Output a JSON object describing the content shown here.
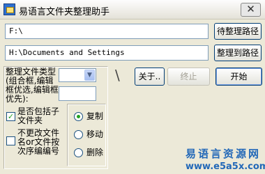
{
  "window": {
    "title": "易语言文件夹整理助手",
    "close_glyph": "✕"
  },
  "paths": {
    "source_value": "F:\\",
    "target_value": "H:\\Documents and Settings",
    "source_button": "待整理路径",
    "target_button": "整理到路径"
  },
  "options": {
    "category_label": "整理文件类型(组合框,编辑框优选,编辑框优先):",
    "include_subfolders_label": "是否包括子文件夹",
    "include_subfolders_checked": true,
    "rename_label": "不更改文件名or文件按次序编编号",
    "rename_checked": false,
    "mode_copy": "复制",
    "mode_move": "移动",
    "mode_delete": "删除",
    "selected_mode": "复制"
  },
  "actions": {
    "about": "关于..",
    "stop": "终止",
    "start": "开始",
    "separator_glyph": "\\"
  },
  "watermark": {
    "site_name": "易语言资源网",
    "site_url": "www.e5a5x.com"
  }
}
